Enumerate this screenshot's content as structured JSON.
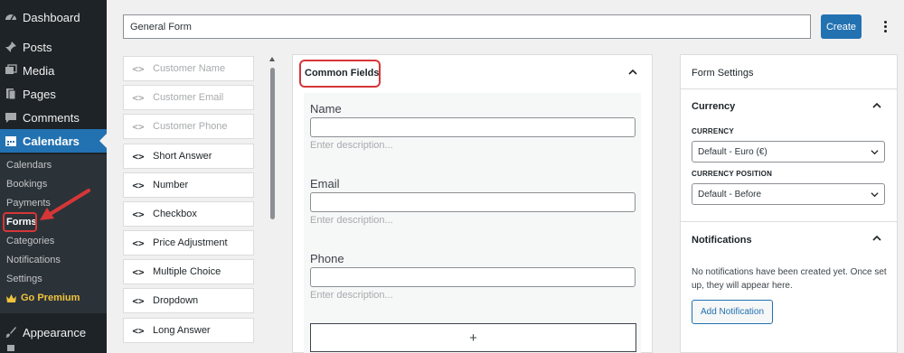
{
  "sidebar": {
    "top_items": [
      {
        "label": "Dashboard",
        "icon": "dashboard-icon"
      },
      {
        "label": "Posts",
        "icon": "pin-icon"
      },
      {
        "label": "Media",
        "icon": "media-icon"
      },
      {
        "label": "Pages",
        "icon": "pages-icon"
      },
      {
        "label": "Comments",
        "icon": "comment-icon"
      },
      {
        "label": "Calendars",
        "icon": "calendar-icon"
      }
    ],
    "submenu": [
      "Calendars",
      "Bookings",
      "Payments",
      "Forms",
      "Categories",
      "Notifications",
      "Settings"
    ],
    "premium_label": "Go Premium",
    "bottom_items": [
      {
        "label": "Appearance",
        "icon": "brush-icon"
      }
    ]
  },
  "form": {
    "title_value": "General Form",
    "create_label": "Create"
  },
  "field_palette": [
    {
      "label": "Customer Name",
      "enabled": false
    },
    {
      "label": "Customer Email",
      "enabled": false
    },
    {
      "label": "Customer Phone",
      "enabled": false
    },
    {
      "label": "Short Answer",
      "enabled": true
    },
    {
      "label": "Number",
      "enabled": true
    },
    {
      "label": "Checkbox",
      "enabled": true
    },
    {
      "label": "Price Adjustment",
      "enabled": true
    },
    {
      "label": "Multiple Choice",
      "enabled": true
    },
    {
      "label": "Dropdown",
      "enabled": true
    },
    {
      "label": "Long Answer",
      "enabled": true
    }
  ],
  "canvas": {
    "section_title": "Common Fields",
    "fields": [
      {
        "label": "Name",
        "description_placeholder": "Enter description..."
      },
      {
        "label": "Email",
        "description_placeholder": "Enter description..."
      },
      {
        "label": "Phone",
        "description_placeholder": "Enter description..."
      }
    ],
    "add_symbol": "+"
  },
  "settings": {
    "heading": "Form Settings",
    "currency": {
      "title": "Currency",
      "currency_label": "CURRENCY",
      "currency_value": "Default - Euro (€)",
      "position_label": "CURRENCY POSITION",
      "position_value": "Default - Before"
    },
    "notifications": {
      "title": "Notifications",
      "empty_text": "No notifications have been created yet. Once set up, they will appear here.",
      "add_label": "Add Notification"
    }
  },
  "colors": {
    "sidebar_bg": "#1d2327",
    "accent": "#2271b1",
    "highlight_red": "#d63638",
    "premium": "#f0c33c"
  }
}
